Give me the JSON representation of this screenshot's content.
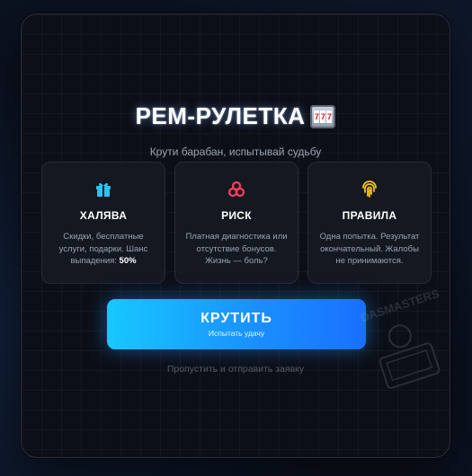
{
  "modal": {
    "title": "РЕМ-РУЛЕТКА",
    "title_icon": "slot-machine-icon",
    "subtitle": "Крути барабан, испытывай судьбу"
  },
  "cards": [
    {
      "icon": "gift-icon",
      "icon_color": "#2bc4f2",
      "title": "ХАЛЯВА",
      "text": "Скидки, бесплатные услуги, подарки. Шанс выпадения:",
      "highlight": "50%"
    },
    {
      "icon": "biohazard-icon",
      "icon_color": "#ff3d5e",
      "title": "РИСК",
      "text": "Платная диагностика или отсутствие бонусов. Жизнь — боль?"
    },
    {
      "icon": "fingerprint-icon",
      "icon_color": "#f5c518",
      "title": "ПРАВИЛА",
      "text": "Одна попытка. Результат окончательный. Жалобы не принимаются."
    }
  ],
  "spin_button": {
    "label": "КРУТИТЬ",
    "sublabel": "Испытать удачу"
  },
  "skip_link": "Пропустить и отправить заявку",
  "watermark_text": "DASMASTERS",
  "colors": {
    "accent_start": "#17c8ff",
    "accent_end": "#1970ff",
    "background": "#0c0f17"
  }
}
